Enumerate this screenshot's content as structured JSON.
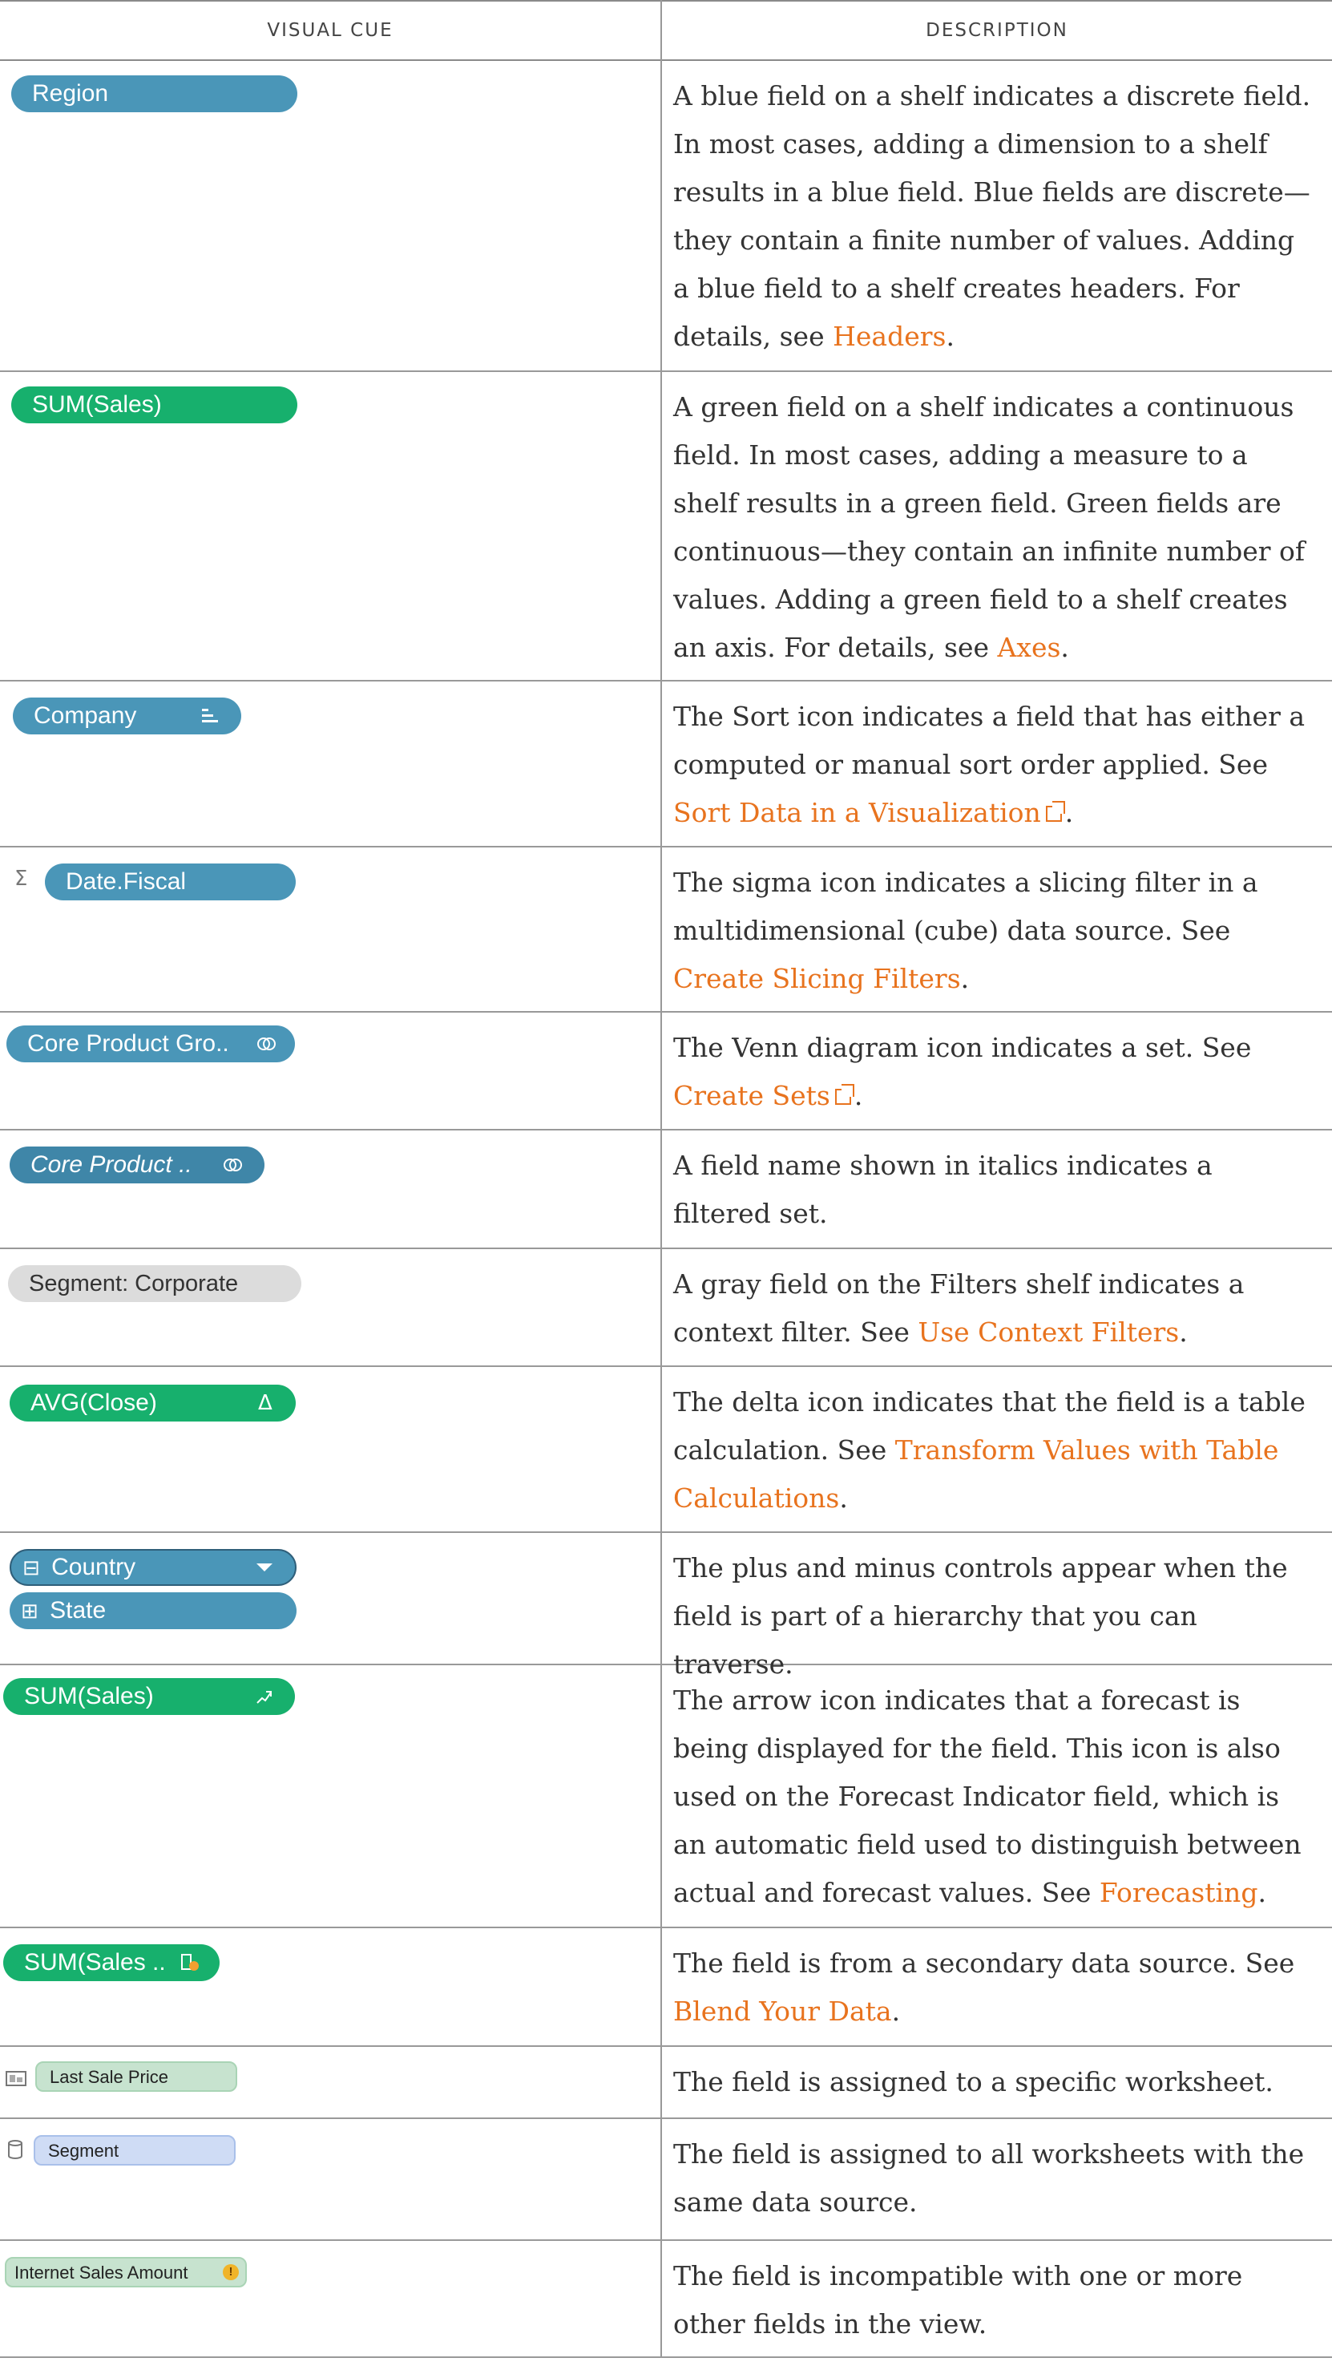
{
  "header": {
    "col1": "VISUAL CUE",
    "col2": "DESCRIPTION"
  },
  "rows": [
    {
      "cue": "Region",
      "d": "A blue field on a shelf indicates a discrete field. In most cases, adding a dimension to a shelf results in a blue field. Blue fields are discrete—they contain a finite number of values. Adding a blue field to a shelf creates headers. For details, see ",
      "link": "Headers",
      "end": "."
    },
    {
      "cue": "SUM(Sales)",
      "d": "A green field on a shelf indicates a continuous field. In most cases, adding a measure to a shelf results in a green field. Green fields are continuous—they contain an infinite number of values. Adding a green field to a shelf creates an axis. For details, see ",
      "link": "Axes",
      "end": "."
    },
    {
      "cue": "Company",
      "d": "The Sort icon indicates a field that has either a computed or manual sort order applied. See ",
      "link": "Sort Data in a Visualization",
      "end": "."
    },
    {
      "cue": "Date.Fiscal",
      "sigma": "Σ",
      "d": "The sigma icon indicates a slicing filter in a multidimensional (cube) data source. See ",
      "link": "Create Slicing Filters",
      "end": "."
    },
    {
      "cue": "Core Product Gro..",
      "d": "The Venn diagram icon indicates a set. See ",
      "link": "Create Sets",
      "end": "."
    },
    {
      "cue": "Core Product ..",
      "d": "A field name shown in italics indicates a filtered set."
    },
    {
      "cue": "Segment: Corporate",
      "d": "A gray field on the Filters shelf indicates a context filter. See ",
      "link": "Use Context Filters",
      "end": "."
    },
    {
      "cue": "AVG(Close)",
      "delta": "Δ",
      "d": "The delta icon indicates that the field is a table calculation. See ",
      "link": "Transform Values with Table Calculations",
      "end": "."
    },
    {
      "cue": "Country",
      "cue2": "State",
      "minus": "⊟",
      "plus": "⊞",
      "d": "The plus and minus controls appear when the field is part of a hierarchy that you can traverse."
    },
    {
      "cue": "SUM(Sales)",
      "d": "The arrow icon indicates that a forecast is being displayed for the field. This icon is also used on the Forecast Indicator field, which is an automatic field used to distinguish between actual and forecast values. See ",
      "link": "Forecasting",
      "end": "."
    },
    {
      "cue": "SUM(Sales ..",
      "d": "The field is from a secondary data source. See ",
      "link": "Blend Your Data",
      "end": "."
    },
    {
      "cue": "Last Sale Price",
      "d": "The field is assigned to a specific worksheet."
    },
    {
      "cue": "Segment",
      "d": "The field is assigned to all worksheets with the same data source."
    },
    {
      "cue": "Internet Sales Amount",
      "warn": "!",
      "d": "The field is incompatible with one or more other fields in the view."
    }
  ]
}
